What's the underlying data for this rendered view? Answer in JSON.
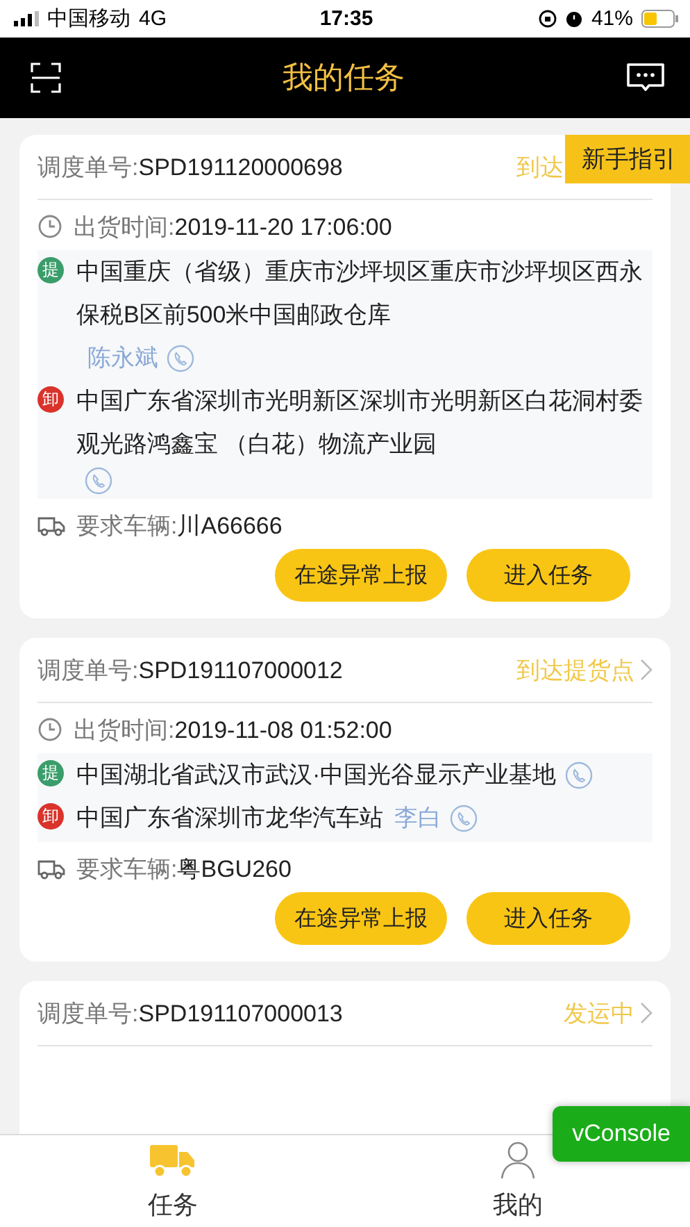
{
  "status_bar": {
    "carrier": "中国移动",
    "network": "4G",
    "time": "17:35",
    "battery": "41%"
  },
  "header": {
    "title": "我的任务"
  },
  "guide_badge": "新手指引",
  "tasks": [
    {
      "order_label": "调度单号:",
      "order_no": "SPD191120000698",
      "status": "到达",
      "status_arrow": false,
      "time_label": "出货时间:",
      "time": "2019-11-20 17:06:00",
      "stops": [
        {
          "kind": "pickup",
          "mark": "提",
          "address": "中国重庆（省级）重庆市沙坪坝区重庆市沙坪坝区西永保税B区前500米中国邮政仓库",
          "contact": "陈永斌"
        },
        {
          "kind": "drop",
          "mark": "卸",
          "address": "中国广东省深圳市光明新区深圳市光明新区白花洞村委观光路鸿鑫宝 （白花）物流产业园"
        }
      ],
      "vehicle_label": "要求车辆:",
      "vehicle": "川A66666",
      "buttons": [
        "在途异常上报",
        "进入任务"
      ]
    },
    {
      "order_label": "调度单号:",
      "order_no": "SPD191107000012",
      "status": "到达提货点",
      "status_arrow": true,
      "time_label": "出货时间:",
      "time": "2019-11-08 01:52:00",
      "stops": [
        {
          "kind": "pickup",
          "mark": "提",
          "address": "中国湖北省武汉市武汉·中国光谷显示产业基地"
        },
        {
          "kind": "drop",
          "mark": "卸",
          "address": "中国广东省深圳市龙华汽车站",
          "contact": "李白"
        }
      ],
      "vehicle_label": "要求车辆:",
      "vehicle": "粤BGU260",
      "buttons": [
        "在途异常上报",
        "进入任务"
      ]
    },
    {
      "order_label": "调度单号:",
      "order_no": "SPD191107000013",
      "status": "发运中",
      "status_arrow": true
    }
  ],
  "tabs": [
    {
      "label": "任务",
      "selected": true
    },
    {
      "label": "我的",
      "selected": false
    }
  ],
  "vconsole": "vConsole"
}
